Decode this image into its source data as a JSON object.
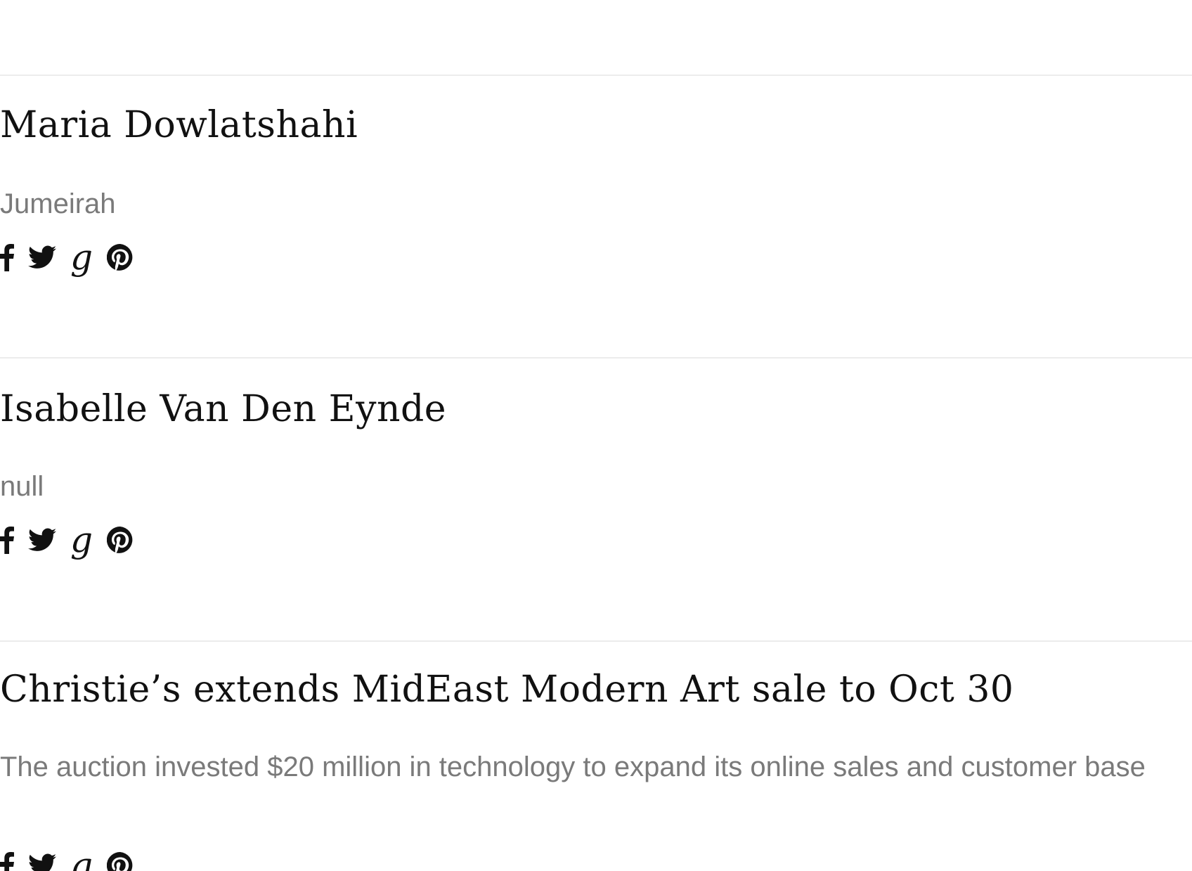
{
  "articles": [
    {
      "title": "Maria Dowlatshahi",
      "excerpt": "Jumeirah",
      "share": {
        "facebook": "facebook-icon",
        "twitter": "twitter-icon",
        "googleplus": "g",
        "pinterest": "pinterest-icon"
      }
    },
    {
      "title": "Isabelle Van Den Eynde",
      "excerpt": "null",
      "share": {
        "facebook": "facebook-icon",
        "twitter": "twitter-icon",
        "googleplus": "g",
        "pinterest": "pinterest-icon"
      }
    },
    {
      "title": "Christie’s extends MidEast Modern Art sale to Oct 30",
      "excerpt": "The auction invested $20 million in technology to expand its online sales and customer base",
      "share": {
        "facebook": "facebook-icon",
        "twitter": "twitter-icon",
        "googleplus": "g",
        "pinterest": "pinterest-icon"
      }
    }
  ],
  "colors": {
    "title": "#111111",
    "excerpt": "#7a7a7a",
    "divider": "#ececec",
    "background": "#ffffff"
  }
}
